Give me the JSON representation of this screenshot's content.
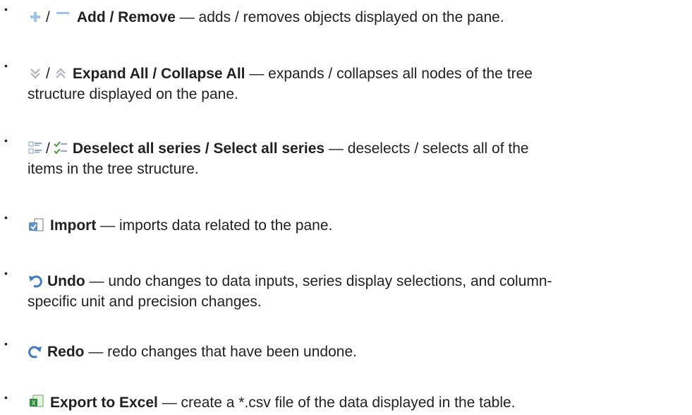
{
  "items": [
    {
      "icons": [
        "add-icon",
        "remove-icon"
      ],
      "title": "Add / Remove",
      "desc_line1": " — adds / removes objects displayed on the pane.",
      "desc_line2": ""
    },
    {
      "icons": [
        "expand-all-icon",
        "collapse-all-icon"
      ],
      "title": "Expand All / Collapse All",
      "desc_line1": " — expands / collapses all nodes of the tree",
      "desc_line2": "structure displayed on the pane."
    },
    {
      "icons": [
        "deselect-all-icon",
        "select-all-icon"
      ],
      "title": "Deselect all series / Select all series",
      "desc_line1": " — deselects / selects all of the",
      "desc_line2": "items in the tree structure."
    },
    {
      "icons": [
        "import-icon"
      ],
      "title": "Import",
      "desc_line1": " — imports data related to the pane.",
      "desc_line2": ""
    },
    {
      "icons": [
        "undo-icon"
      ],
      "title": "Undo",
      "desc_line1": " — undo changes to data inputs, series display selections, and column-",
      "desc_line2": "specific unit and precision changes."
    },
    {
      "icons": [
        "redo-icon"
      ],
      "title": "Redo",
      "desc_line1": " — redo changes that have been undone.",
      "desc_line2": ""
    },
    {
      "icons": [
        "excel-export-icon"
      ],
      "title": "Export to Excel",
      "desc_line1": " — create a *.csv file of the data displayed in the table.",
      "desc_line2": ""
    }
  ],
  "separator": "/",
  "bullet": "•"
}
